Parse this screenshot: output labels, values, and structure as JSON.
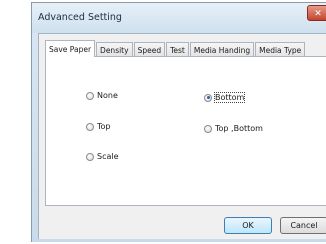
{
  "window": {
    "title": "Advanced Setting",
    "close_glyph": "✕"
  },
  "tabs": [
    {
      "label": "Save Paper",
      "active": true
    },
    {
      "label": "Density",
      "active": false
    },
    {
      "label": "Speed",
      "active": false
    },
    {
      "label": "Test",
      "active": false
    },
    {
      "label": "Media Handing",
      "active": false
    },
    {
      "label": "Media Type",
      "active": false
    }
  ],
  "options": [
    {
      "label": "None",
      "selected": false
    },
    {
      "label": "Top",
      "selected": false
    },
    {
      "label": "Scale",
      "selected": false
    },
    {
      "label": "Bottom",
      "selected": true
    },
    {
      "label": "Top ,Bottom",
      "selected": false
    }
  ],
  "buttons": {
    "ok": "OK",
    "cancel": "Cancel"
  },
  "colors": {
    "accent": "#2d5fa8",
    "close_button": "#c2452f"
  }
}
